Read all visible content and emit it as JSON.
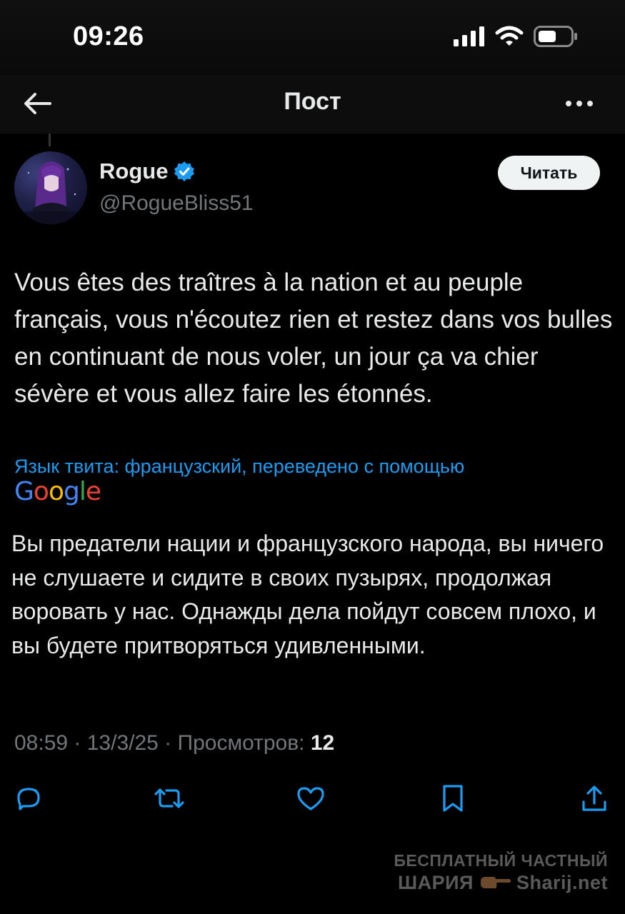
{
  "status_bar": {
    "time": "09:26"
  },
  "nav": {
    "title": "Пост"
  },
  "author": {
    "display_name": "Rogue",
    "handle": "@RogueBliss51",
    "verified": true
  },
  "follow_button": {
    "label": "Читать"
  },
  "post": {
    "text": "Vous êtes des traîtres à la nation et au peuple français, vous n'écoutez rien et restez dans vos bulles en continuant de nous voler, un jour ça va chier sévère et vous allez faire les étonnés."
  },
  "translation": {
    "label": "Язык твита: французский, переведено с помощью",
    "provider": "Google",
    "text": "Вы предатели нации и французского народа, вы ничего не слушаете и сидите в своих пузырях, продолжая воровать у нас. Однажды дела пойдут совсем плохо, и вы будете притворяться удивленными."
  },
  "meta": {
    "time": "08:59",
    "separator": " · ",
    "date": "13/3/25",
    "views_label": "Просмотров: ",
    "views_count": "12"
  },
  "actions": [
    "reply-icon",
    "retweet-icon",
    "like-icon",
    "bookmark-icon",
    "share-icon"
  ],
  "watermark": {
    "line1": "БЕСПЛАТНЫЙ ЧАСТНЫЙ",
    "line2_left": "ШАРИЯ",
    "line2_right": "Sharij.net"
  },
  "colors": {
    "accent": "#1d9bf0",
    "background": "#000000",
    "text": "#e7e9ea",
    "secondary": "#71767b"
  }
}
